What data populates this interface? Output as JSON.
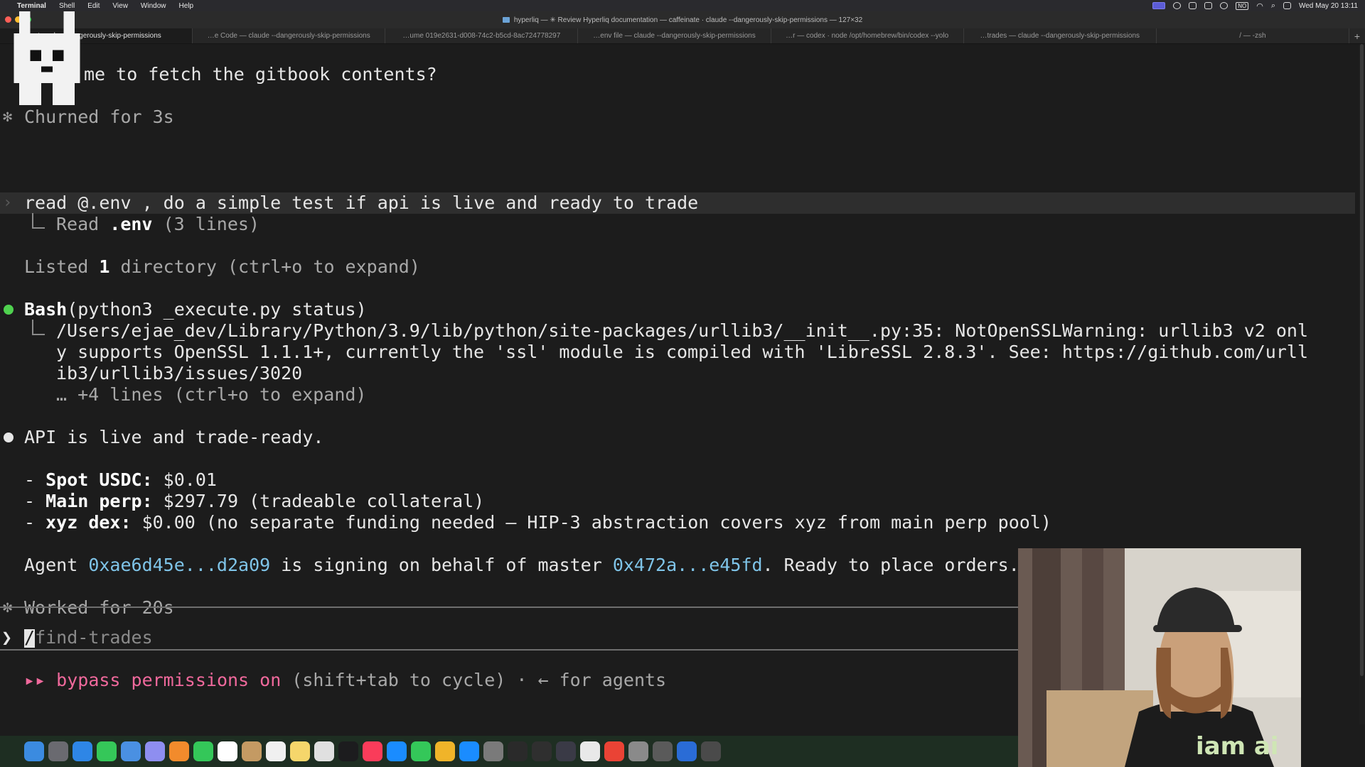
{
  "menubar": {
    "app": "Terminal",
    "items": [
      "Shell",
      "Edit",
      "View",
      "Window",
      "Help"
    ],
    "datetime": "Wed May 20  13:11",
    "tray_icons": [
      "screen-record-icon",
      "creative-cloud-icon",
      "script-icon",
      "shield-icon",
      "media-icon",
      "keyboard-layout-icon",
      "wifi-icon",
      "search-icon",
      "control-center-icon"
    ],
    "keyboard_layout": "NO"
  },
  "window": {
    "title": "hyperliq — ✳ Review Hyperliq documentation — caffeinate · claude --dangerously-skip-permissions — 127×32"
  },
  "tabs": [
    {
      "label": "…te · cl…--dangerously-skip-permissions",
      "active": true
    },
    {
      "label": "…e Code — claude --dangerously-skip-permissions",
      "active": false
    },
    {
      "label": "…ume 019e2631-d008-74c2-b5cd-8ac724778297",
      "active": false
    },
    {
      "label": "…env file — claude --dangerously-skip-permissions",
      "active": false
    },
    {
      "label": "…r — codex · node /opt/homebrew/bin/codex --yolo",
      "active": false
    },
    {
      "label": "…trades — claude --dangerously-skip-permissions",
      "active": false
    },
    {
      "label": "/ — -zsh",
      "active": false
    }
  ],
  "terminal": {
    "question_tail": "me to fetch the gitbook contents?",
    "churned": "Churned for 3s",
    "user_input": "read @.env , do a simple test if api is live and ready to trade",
    "read_label": "Read ",
    "read_file": ".env",
    "read_lines": " (3 lines)",
    "listed_prefix": "Listed ",
    "listed_count": "1",
    "listed_suffix": " directory (ctrl+o to expand)",
    "bash_tool": "Bash",
    "bash_cmd": "(python3 _execute.py status)",
    "warn_line1": "/Users/ejae_dev/Library/Python/3.9/lib/python/site-packages/urllib3/__init__.py:35: NotOpenSSLWarning: urllib3 v2 onl",
    "warn_line2": "y supports OpenSSL 1.1.1+, currently the 'ssl' module is compiled with 'LibreSSL 2.8.3'. See: https://github.com/urll",
    "warn_line3": "ib3/urllib3/issues/3020",
    "more_lines": "… +4 lines (ctrl+o to expand)",
    "api_status": "API is live and trade-ready.",
    "balances": [
      {
        "label": "Spot USDC:",
        "value": " $0.01"
      },
      {
        "label": "Main perp:",
        "value": " $297.79 (tradeable collateral)"
      },
      {
        "label": "xyz dex:",
        "value": " $0.00 (no separate funding needed — HIP-3 abstraction covers xyz from main perp pool)"
      }
    ],
    "agent_prefix": "Agent ",
    "agent_addr": "0xae6d45e...d2a09",
    "agent_mid": " is signing on behalf of master ",
    "master_addr": "0x472a...e45fd",
    "agent_suffix": ". Ready to place orders.",
    "worked": "Worked for 20s",
    "prompt_symbol": "❯",
    "prompt_input": "find-trades",
    "prompt_slash": "/",
    "mode_arrows": "▸▸",
    "mode_text": "bypass permissions on",
    "mode_hint": " (shift+tab to cycle) · ← for agents"
  },
  "webcam": {
    "shirt_text": "iam ai"
  },
  "dock": {
    "colors": [
      "#3b8be0",
      "#6a6a70",
      "#2e86e6",
      "#35c759",
      "#4a90e2",
      "#8e8ef0",
      "#f28b2c",
      "#34c759",
      "#ffffff",
      "#c49a63",
      "#f0f0f0",
      "#f5d66b",
      "#e0e0e0",
      "#1c1c1e",
      "#fa3c5a",
      "#1a8cff",
      "#34c759",
      "#f0b429",
      "#1a8cff",
      "#7a7a7a",
      "#2a2a2a",
      "#2f2f2f",
      "#3a3a46",
      "#e9e9e9",
      "#ea4335",
      "#8a8a8a",
      "#5a5a5a",
      "#2a6cd6",
      "#4a4a4a"
    ]
  }
}
